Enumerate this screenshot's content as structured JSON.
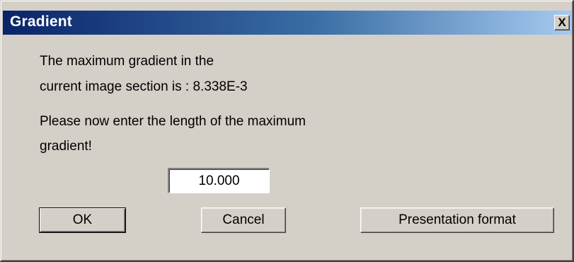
{
  "dialog": {
    "title": "Gradient",
    "close_glyph": "X"
  },
  "message": {
    "line1": "The maximum gradient in the",
    "line2": "current image section is :  8.338E-3",
    "line3": "Please now enter the length of the maximum",
    "line4": "gradient!"
  },
  "length_input": {
    "value": "10.000"
  },
  "buttons": {
    "ok": "OK",
    "cancel": "Cancel",
    "presentation": "Presentation format"
  },
  "colors": {
    "face": "#d4d0c8",
    "title_start": "#0a246a",
    "title_end": "#a6caf0"
  }
}
